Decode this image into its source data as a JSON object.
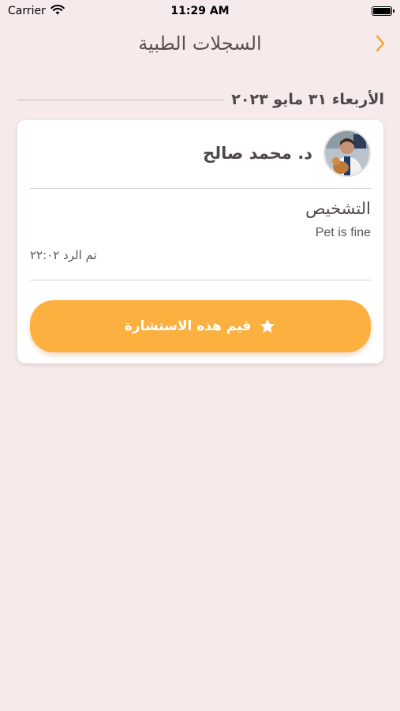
{
  "status_bar": {
    "carrier": "Carrier",
    "time": "11:29 AM"
  },
  "nav": {
    "title": "السجلات الطبية"
  },
  "record": {
    "date": "الأربعاء ٣١ مايو ٢٠٢٣",
    "doctor_name": "د. محمد صالح",
    "diagnosis_title": "التشخيص",
    "diagnosis_text": "Pet is fine",
    "reply_time": "تم الرد ٢٢:٠٢",
    "rate_label": "قيم هذه الاستشارة"
  },
  "colors": {
    "background": "#f7eaea",
    "accent": "#fbb040",
    "card": "#ffffff"
  }
}
